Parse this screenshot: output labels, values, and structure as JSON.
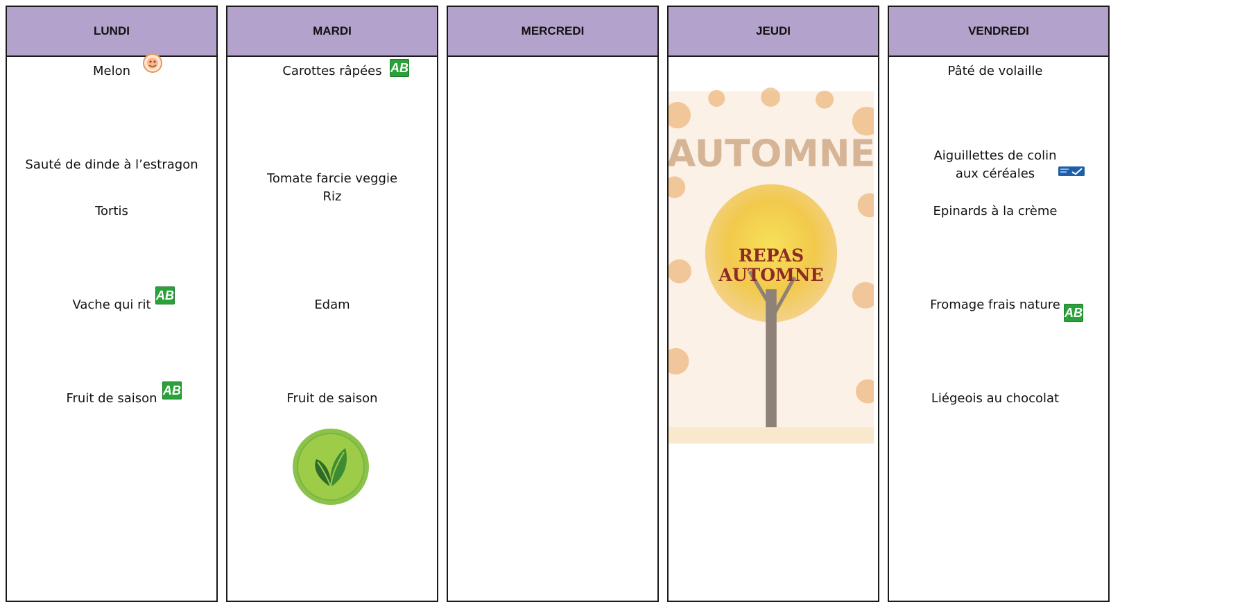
{
  "days": [
    {
      "name": "LUNDI",
      "items": [
        "Melon",
        "Sauté de dinde à l’estragon",
        "Tortis",
        "Vache qui rit",
        "Fruit de saison"
      ]
    },
    {
      "name": "MARDI",
      "items": [
        "Carottes râpées",
        "Tomate farcie veggie",
        "Riz",
        "Edam",
        "Fruit de saison"
      ]
    },
    {
      "name": "MERCREDI",
      "items": []
    },
    {
      "name": "JEUDI",
      "items": [],
      "image_caption_line1": "REPAS",
      "image_caption_line2": "AUTOMNE",
      "image_title": "AUTOMNE"
    },
    {
      "name": "VENDREDI",
      "items": [
        "Pâté de volaille",
        "Aiguillettes de colin",
        "aux céréales",
        "Epinards à la crème",
        "Fromage frais nature",
        "Liégeois au chocolat"
      ]
    }
  ],
  "icons": {
    "organic_label": "AB",
    "organic": "organic-ab-logo-icon",
    "local": "local-product-logo-icon",
    "msc": "msc-sustainable-fishing-icon",
    "vegetarian": "vegetarian-leaf-badge-icon"
  },
  "colors": {
    "header_bg": "#b3a2cb",
    "organic_green": "#2aa23a",
    "caption_red": "#8e2a24"
  }
}
